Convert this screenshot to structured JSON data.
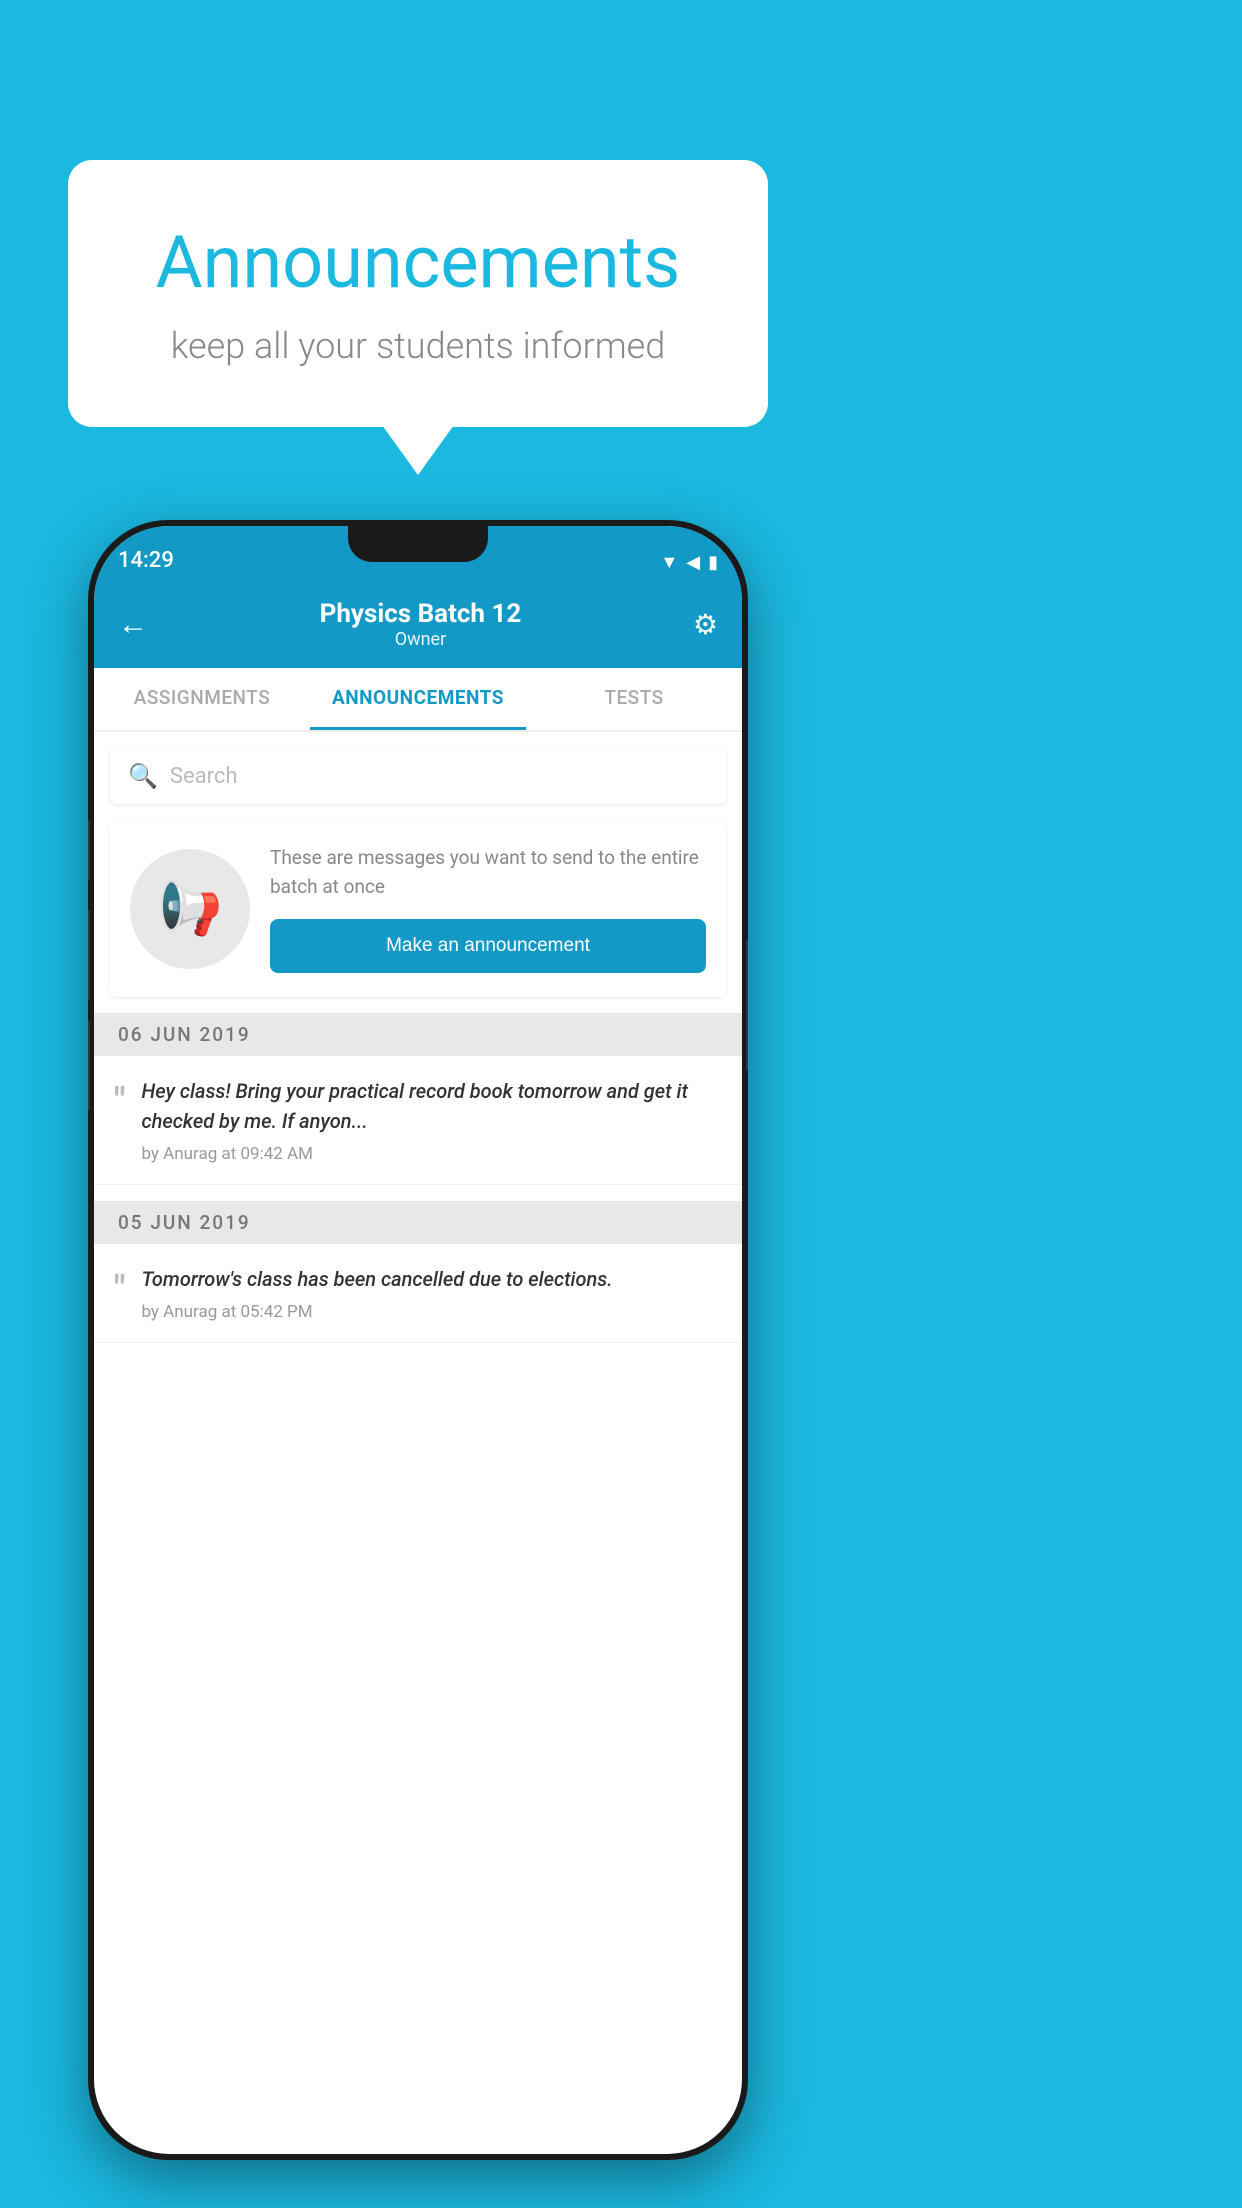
{
  "background": {
    "color": "#1bb8e0"
  },
  "speech_bubble": {
    "title": "Announcements",
    "subtitle": "keep all your students informed"
  },
  "phone": {
    "status_bar": {
      "time": "14:29",
      "icons": "▼◀▮"
    },
    "header": {
      "title": "Physics Batch 12",
      "subtitle": "Owner",
      "back_label": "←",
      "gear_label": "⚙"
    },
    "tabs": [
      {
        "label": "ASSIGNMENTS",
        "active": false
      },
      {
        "label": "ANNOUNCEMENTS",
        "active": true
      },
      {
        "label": "TESTS",
        "active": false
      }
    ],
    "search": {
      "placeholder": "Search"
    },
    "announcement_prompt": {
      "description": "These are messages you want to send to the entire batch at once",
      "button_label": "Make an announcement"
    },
    "announcement_groups": [
      {
        "date": "06  JUN  2019",
        "items": [
          {
            "text": "Hey class! Bring your practical record book tomorrow and get it checked by me. If anyon...",
            "author": "by Anurag at 09:42 AM"
          }
        ]
      },
      {
        "date": "05  JUN  2019",
        "items": [
          {
            "text": "Tomorrow's class has been cancelled due to elections.",
            "author": "by Anurag at 05:42 PM"
          }
        ]
      }
    ]
  }
}
